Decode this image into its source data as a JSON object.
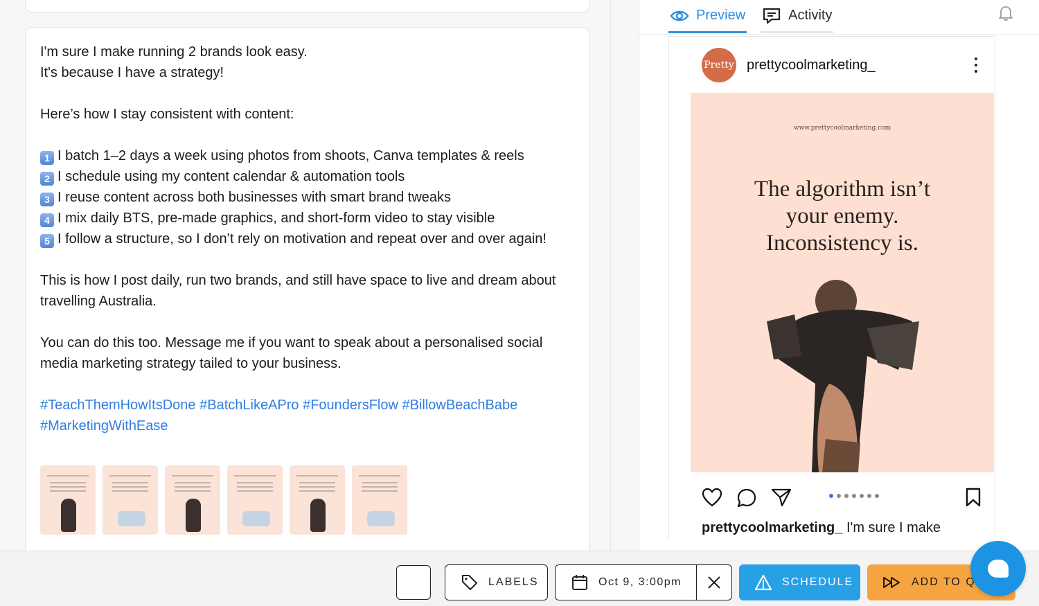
{
  "caption": {
    "lines": [
      "I'm sure I make running 2 brands look easy.",
      "It's because I have a strategy!",
      "",
      "Here’s how I stay consistent with content:",
      ""
    ],
    "steps": [
      {
        "num": "1",
        "text": "I batch 1–2 days a week using photos from shoots, Canva templates & reels"
      },
      {
        "num": "2",
        "text": "I schedule using my content calendar & automation tools"
      },
      {
        "num": "3",
        "text": "I reuse content across both businesses with smart brand tweaks"
      },
      {
        "num": "4",
        "text": "I mix daily BTS, pre-made graphics, and short-form video to stay visible"
      },
      {
        "num": "5",
        "text": "I follow a structure, so I don’t rely on motivation and repeat over and over again!"
      }
    ],
    "paragraph_1": "This is how I post daily, run two brands, and still have space to live and dream about travelling Australia.",
    "paragraph_2": "You can do this too. Message me if you want to speak about a personalised social media marketing strategy tailed to your business.",
    "hashtags": "#TeachThemHowItsDone #BatchLikeAPro #FoundersFlow #BillowBeachBabe #MarketingWithEase"
  },
  "thumbnail_count": 6,
  "tabs": {
    "preview": "Preview",
    "activity": "Activity"
  },
  "instagram": {
    "avatar_text": "Pretty",
    "username": "prettycoolmarketing_",
    "image_url_text": "www.prettycoolmarketing.com",
    "quote_line_1": "The algorithm isn’t",
    "quote_line_2": "your enemy.",
    "quote_line_3": "Inconsistency is.",
    "caption_user": "prettycoolmarketing_",
    "caption_text": " I'm sure I make",
    "carousel_total": 7,
    "carousel_active": 1
  },
  "bottom_bar": {
    "labels_button": "LABELS",
    "date_value": "Oct 9, 3:00pm",
    "schedule_button": "SCHEDULE",
    "queue_button": "ADD TO QUEUE"
  },
  "colors": {
    "accent_blue": "#2e8fde",
    "schedule_blue": "#27a0e6",
    "queue_orange": "#f6a441",
    "hashtag_blue": "#2f7de1",
    "post_background": "#fde0d2"
  },
  "icons": [
    "eye-icon",
    "comment-icon",
    "bell-icon",
    "heart-icon",
    "message-bubble-icon",
    "send-icon",
    "bookmark-icon",
    "tag-icon",
    "calendar-icon",
    "close-icon",
    "schedule-triangle-icon",
    "fast-forward-icon",
    "chat-icon"
  ]
}
